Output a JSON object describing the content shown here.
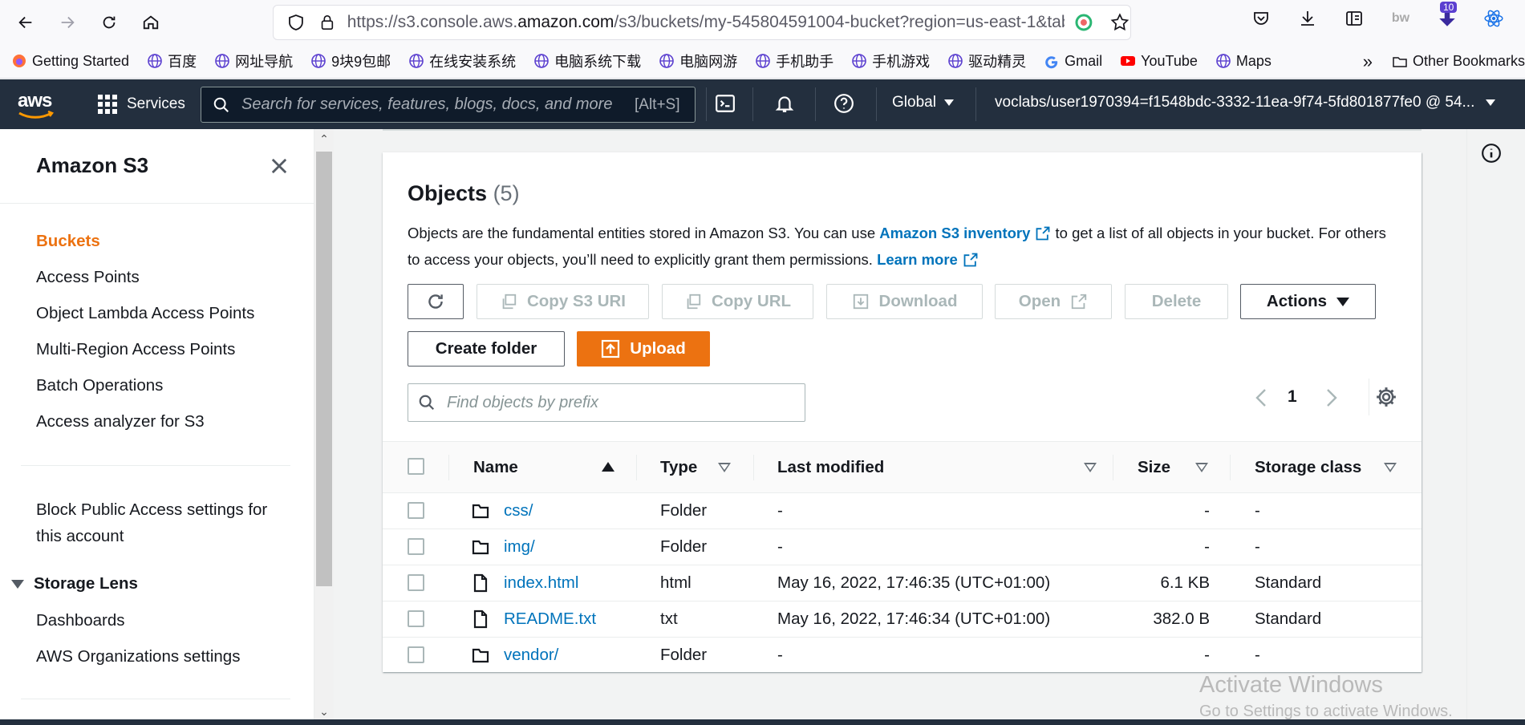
{
  "browser": {
    "url_prefix": "https://s3.console.aws.",
    "url_domain": "amazon.com",
    "url_suffix": "/s3/buckets/my-545804591004-bucket?region=us-east-1&tab",
    "extension_badge": "10",
    "bookmarks": [
      {
        "label": "Getting Started",
        "icon": "firefox-icon"
      },
      {
        "label": "百度",
        "icon": "globe-icon"
      },
      {
        "label": "网址导航",
        "icon": "globe-icon"
      },
      {
        "label": "9块9包邮",
        "icon": "globe-icon"
      },
      {
        "label": "在线安装系统",
        "icon": "globe-icon"
      },
      {
        "label": "电脑系统下载",
        "icon": "globe-icon"
      },
      {
        "label": "电脑网游",
        "icon": "globe-icon"
      },
      {
        "label": "手机助手",
        "icon": "globe-icon"
      },
      {
        "label": "手机游戏",
        "icon": "globe-icon"
      },
      {
        "label": "驱动精灵",
        "icon": "globe-icon"
      },
      {
        "label": "Gmail",
        "icon": "google-icon"
      },
      {
        "label": "YouTube",
        "icon": "youtube-icon"
      },
      {
        "label": "Maps",
        "icon": "globe-icon"
      }
    ],
    "other_bookmarks": "Other Bookmarks"
  },
  "aws_nav": {
    "logo": "aws",
    "services": "Services",
    "search_placeholder": "Search for services, features, blogs, docs, and more",
    "search_shortcut": "[Alt+S]",
    "region": "Global",
    "account": "voclabs/user1970394=f1548bdc-3332-11ea-9f74-5fd801877fe0 @ 54..."
  },
  "sidebar": {
    "title": "Amazon S3",
    "items": [
      {
        "label": "Buckets",
        "active": true
      },
      {
        "label": "Access Points"
      },
      {
        "label": "Object Lambda Access Points"
      },
      {
        "label": "Multi-Region Access Points"
      },
      {
        "label": "Batch Operations"
      },
      {
        "label": "Access analyzer for S3"
      }
    ],
    "block_public_line1": "Block Public Access settings for",
    "block_public_line2": "this account",
    "storage_lens": {
      "title": "Storage Lens",
      "items": [
        "Dashboards",
        "AWS Organizations settings"
      ]
    }
  },
  "objects": {
    "title": "Objects",
    "count": "(5)",
    "desc_1": "Objects are the fundamental entities stored in Amazon S3. You can use ",
    "desc_link1": "Amazon S3 inventory",
    "desc_2": " to get a list of all objects in your bucket. For others to access your objects, you’ll need to explicitly grant them permissions. ",
    "desc_link2": "Learn more",
    "buttons": {
      "copy_s3_uri": "Copy S3 URI",
      "copy_url": "Copy URL",
      "download": "Download",
      "open": "Open",
      "delete": "Delete",
      "actions": "Actions",
      "create_folder": "Create folder",
      "upload": "Upload"
    },
    "filter_placeholder": "Find objects by prefix",
    "page": "1",
    "columns": {
      "name": "Name",
      "type": "Type",
      "last_modified": "Last modified",
      "size": "Size",
      "storage_class": "Storage class"
    },
    "rows": [
      {
        "name": "css/",
        "kind": "folder",
        "type": "Folder",
        "modified": "-",
        "size": "-",
        "storage": "-"
      },
      {
        "name": "img/",
        "kind": "folder",
        "type": "Folder",
        "modified": "-",
        "size": "-",
        "storage": "-"
      },
      {
        "name": "index.html",
        "kind": "file",
        "type": "html",
        "modified": "May 16, 2022, 17:46:35 (UTC+01:00)",
        "size": "6.1 KB",
        "storage": "Standard"
      },
      {
        "name": "README.txt",
        "kind": "file",
        "type": "txt",
        "modified": "May 16, 2022, 17:46:34 (UTC+01:00)",
        "size": "382.0 B",
        "storage": "Standard"
      },
      {
        "name": "vendor/",
        "kind": "folder",
        "type": "Folder",
        "modified": "-",
        "size": "-",
        "storage": "-"
      }
    ]
  },
  "watermark": {
    "line1": "Activate Windows",
    "line2": "Go to Settings to activate Windows."
  },
  "colors": {
    "aws_nav": "#232f3e",
    "accent": "#ec7211",
    "link": "#0073bb"
  }
}
